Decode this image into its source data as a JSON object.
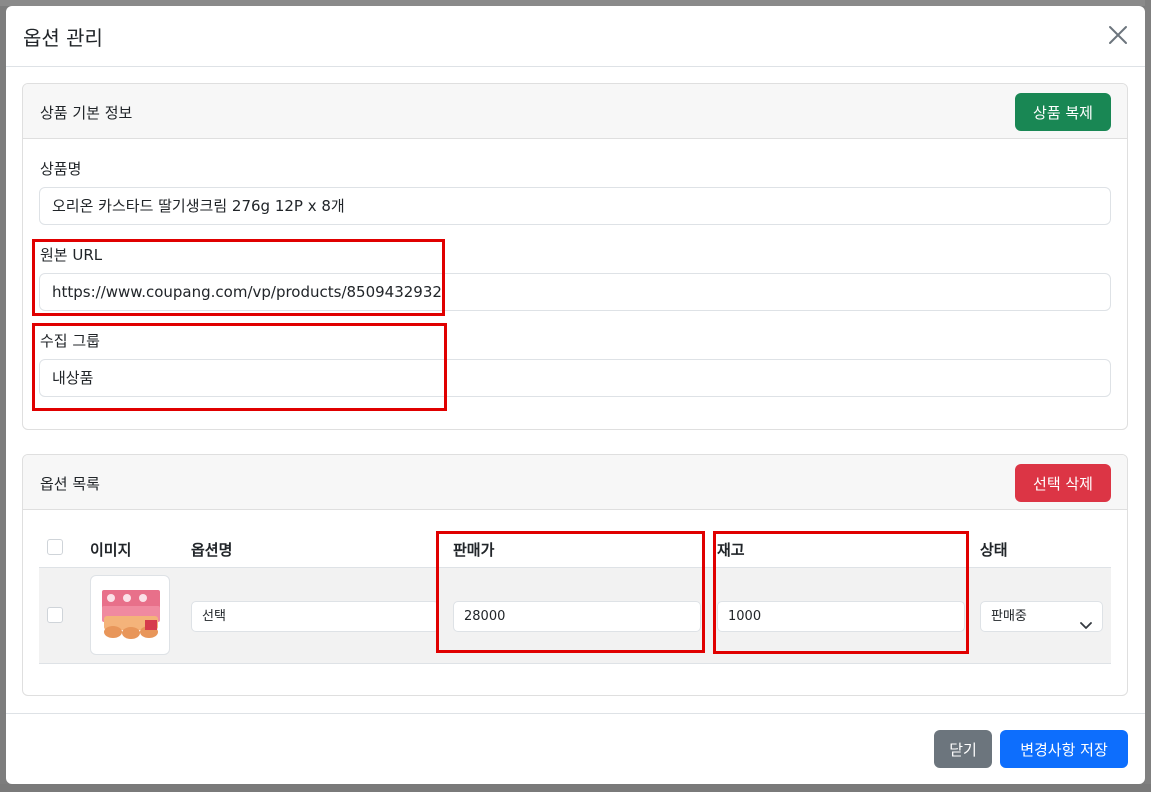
{
  "modal": {
    "title": "옵션 관리"
  },
  "basic_info": {
    "header": "상품 기본 정보",
    "duplicate_button": "상품 복제",
    "product_name_label": "상품명",
    "product_name_value": "오리온 카스타드 딸기생크림 276g 12P x 8개",
    "source_url_label": "원본 URL",
    "source_url_value": "https://www.coupang.com/vp/products/8509432932",
    "collect_group_label": "수집 그룹",
    "collect_group_value": "내상품"
  },
  "options": {
    "header": "옵션 목록",
    "delete_selected_button": "선택 삭제",
    "columns": [
      "이미지",
      "옵션명",
      "판매가",
      "재고",
      "상태"
    ],
    "rows": [
      {
        "option_name": "선택",
        "price": "28000",
        "stock": "1000",
        "status": "판매중"
      }
    ]
  },
  "footer": {
    "close_button": "닫기",
    "save_button": "변경사항 저장"
  },
  "colors": {
    "primary": "#0d6efd",
    "success": "#198754",
    "danger": "#dc3545",
    "secondary": "#6c757d",
    "highlight": "#e00000"
  }
}
